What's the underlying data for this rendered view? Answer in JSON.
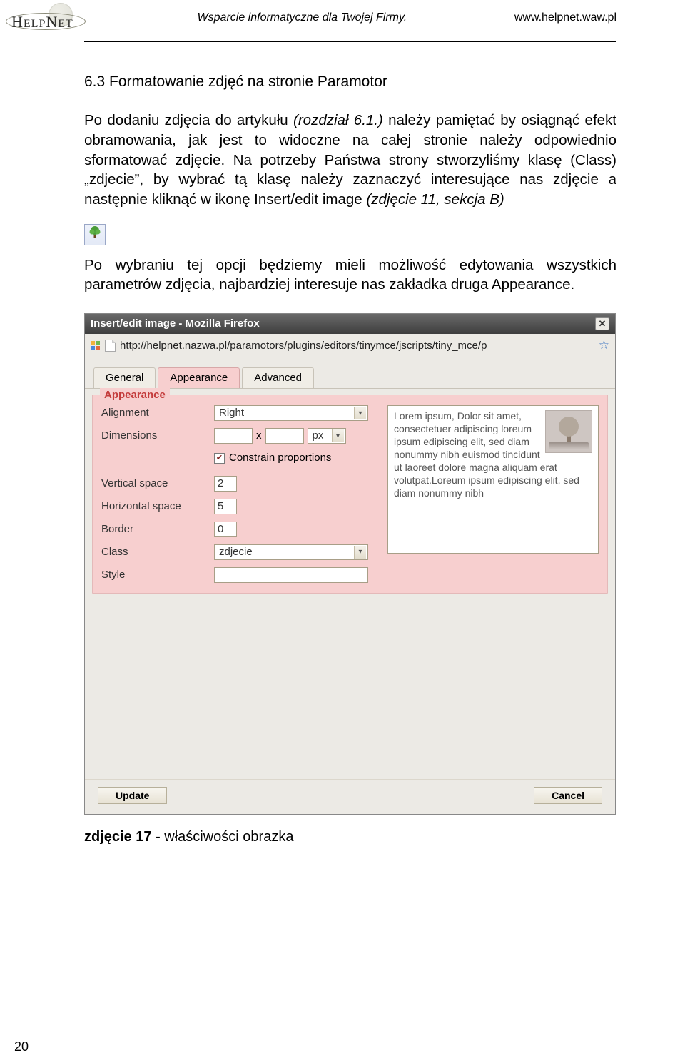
{
  "header": {
    "tagline": "Wsparcie informatyczne dla Twojej Firmy.",
    "url": "www.helpnet.waw.pl",
    "logo_text_a": "H",
    "logo_text_b": "ELP",
    "logo_text_c": "N",
    "logo_text_d": "ET"
  },
  "heading": "6.3 Formatowanie zdjęć na stronie Paramotor",
  "para1_a": "Po dodaniu zdjęcia do artykułu ",
  "para1_b": "(rozdział 6.1.)",
  "para1_c": " należy pamiętać by osiągnąć efekt obramowania, jak jest to widoczne na całej stronie należy odpowiednio sformatować zdjęcie. Na potrzeby Państwa strony stworzyliśmy klasę (Class) „zdjecie”, by wybrać tą klasę należy zaznaczyć interesujące nas zdjęcie a następnie kliknąć w ikonę Insert/edit image ",
  "para1_d": "(zdjęcie 11, sekcja B)",
  "para2": "Po wybraniu tej opcji będziemy mieli możliwość edytowania wszystkich parametrów zdjęcia, najbardziej interesuje nas zakładka druga Appearance.",
  "dialog": {
    "title": "Insert/edit image - Mozilla Firefox",
    "url": "http://helpnet.nazwa.pl/paramotors/plugins/editors/tinymce/jscripts/tiny_mce/p",
    "tabs": [
      "General",
      "Appearance",
      "Advanced"
    ],
    "legend": "Appearance",
    "labels": {
      "alignment": "Alignment",
      "dimensions": "Dimensions",
      "constrain": "Constrain proportions",
      "vspace": "Vertical space",
      "hspace": "Horizontal space",
      "border": "Border",
      "class": "Class",
      "style": "Style"
    },
    "values": {
      "alignment": "Right",
      "dim_x": "x",
      "dim_unit": "px",
      "vspace": "2",
      "hspace": "5",
      "border": "0",
      "class": "zdjecie",
      "style": ""
    },
    "preview_text": "Lorem ipsum, Dolor sit amet, consectetuer adipiscing loreum ipsum edipiscing elit, sed diam nonummy nibh euismod tincidunt ut laoreet dolore magna aliquam erat volutpat.Loreum ipsum edipiscing elit, sed diam nonummy nibh",
    "buttons": {
      "update": "Update",
      "cancel": "Cancel"
    }
  },
  "caption_bold": "zdjęcie 17",
  "caption_rest": " - właściwości obrazka",
  "page_number": "20"
}
